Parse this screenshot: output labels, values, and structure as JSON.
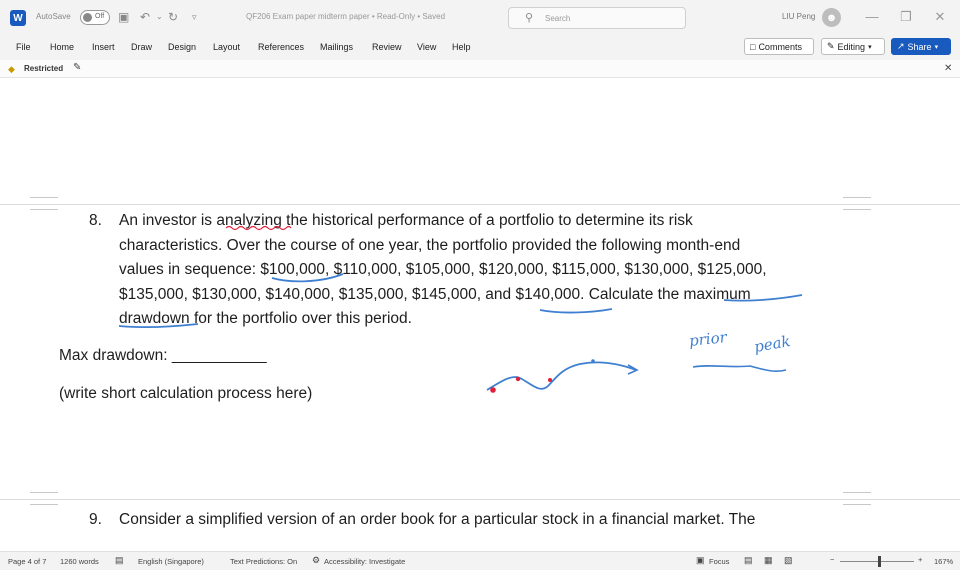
{
  "titlebar": {
    "app_logo": "W",
    "autosave_label": "AutoSave",
    "autosave_state": "Off",
    "save_icon": "save-icon",
    "undo_icon": "undo-icon",
    "redo_icon": "redo-icon",
    "customize_icon": "customize-qat-icon",
    "doc_title": "QF206 Exam paper midterm paper  •  Read-Only  •  Saved",
    "search_placeholder": "Search",
    "user_name": "LIU Peng",
    "minimize": "—",
    "restore": "❐",
    "close": "✕"
  },
  "ribbon": {
    "tabs": [
      "File",
      "Home",
      "Insert",
      "Draw",
      "Design",
      "Layout",
      "References",
      "Mailings",
      "Review",
      "View",
      "Help"
    ],
    "comments_label": "Comments",
    "editing_label": "Editing",
    "share_label": "Share"
  },
  "restricted_bar": {
    "label": "Restricted"
  },
  "document": {
    "q8_number": "8.",
    "q8_lines": [
      "An investor is analyzing the historical performance of a portfolio to determine its risk",
      "characteristics. Over the course of one year, the portfolio provided the following month-end",
      "values in sequence: $100,000, $110,000, $105,000, $120,000, $115,000, $130,000, $125,000,",
      "$135,000, $130,000, $140,000, $135,000, $145,000, and $140,000. Calculate the maximum",
      "drawdown for the portfolio over this period."
    ],
    "max_drawdown_label": "Max drawdown: ___________",
    "calc_hint": "(write short calculation process here)",
    "handwriting": [
      "prior",
      "peak"
    ],
    "q9_number": "9.",
    "q9_line": "Consider a simplified version of an order book for a particular stock in a financial market. The"
  },
  "statusbar": {
    "page": "Page 4 of 7",
    "words": "1260 words",
    "language": "English (Singapore)",
    "predictions": "Text Predictions: On",
    "accessibility": "Accessibility: Investigate",
    "focus": "Focus",
    "zoom": "167%"
  },
  "colors": {
    "brand": "#185abd",
    "ink": "#3f7fd0",
    "ink_red": "#e0203a",
    "spellcheck": "#e0203a"
  }
}
